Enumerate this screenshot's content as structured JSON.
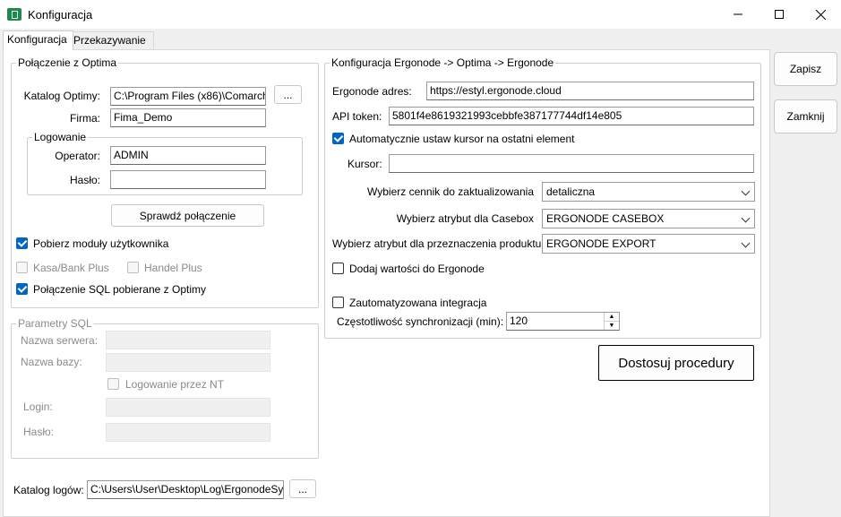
{
  "window": {
    "title": "Konfiguracja",
    "minimize_icon": "minimize-icon",
    "maximize_icon": "maximize-icon",
    "close_icon": "close-icon"
  },
  "tabs": [
    {
      "label": "Konfiguracja",
      "active": true
    },
    {
      "label": "Przekazywanie",
      "active": false
    }
  ],
  "optima": {
    "legend": "Połączenie z Optima",
    "catalog_label": "Katalog Optimy:",
    "catalog_value": "C:\\Program Files (x86)\\Comarch",
    "browse_label": "...",
    "firm_label": "Firma:",
    "firm_value": "Fima_Demo",
    "login_legend": "Logowanie",
    "operator_label": "Operator:",
    "operator_value": "ADMIN",
    "password_label": "Hasło:",
    "password_value": "",
    "check_button": "Sprawdź połączenie",
    "user_modules": {
      "label": "Pobierz moduły użytkownika",
      "checked": true
    },
    "kasa_bank": {
      "label": "Kasa/Bank Plus",
      "checked": false
    },
    "handel": {
      "label": "Handel Plus",
      "checked": false
    },
    "sql_from_optima": {
      "label": "Połączenie SQL pobierane z Optimy",
      "checked": true
    }
  },
  "sql": {
    "legend": "Parametry SQL",
    "server_label": "Nazwa serwera:",
    "db_label": "Nazwa bazy:",
    "nt_login": {
      "label": "Logowanie przez NT",
      "checked": false
    },
    "login_label": "Login:",
    "password_label": "Hasło:"
  },
  "logs": {
    "label": "Katalog logów:",
    "value": "C:\\Users\\User\\Desktop\\Log\\ErgonodeSy",
    "browse_label": "..."
  },
  "ergonode": {
    "legend": "Konfiguracja Ergonode -> Optima -> Ergonode",
    "address_label": "Ergonode adres:",
    "address_value": "https://estyl.ergonode.cloud",
    "token_label": "API token:",
    "token_value": "5801f4e8619321993cebbfe387177744df14e805",
    "auto_cursor": {
      "label": "Automatycznie ustaw kursor na ostatni element",
      "checked": true
    },
    "cursor_label": "Kursor:",
    "cursor_value": "",
    "pricelist_label": "Wybierz cennik do zaktualizowania",
    "pricelist_value": "detaliczna",
    "casebox_label": "Wybierz atrybut dla Casebox",
    "casebox_value": "ERGONODE CASEBOX",
    "purpose_label": "Wybierz atrybut dla przeznaczenia produktu",
    "purpose_value": "ERGONODE EXPORT",
    "add_values": {
      "label": "Dodaj wartości do Ergonode",
      "checked": false
    },
    "auto_integration": {
      "label": "Zautomatyzowana integracja",
      "checked": false
    },
    "sync_freq_label": "Częstotliwość synchronizacji (min):",
    "sync_freq_value": "120"
  },
  "actions": {
    "customize": "Dostosuj procedury",
    "save": "Zapisz",
    "close": "Zamknij"
  },
  "colors": {
    "accent": "#0067c0",
    "app_icon": "#1c8a4a"
  }
}
